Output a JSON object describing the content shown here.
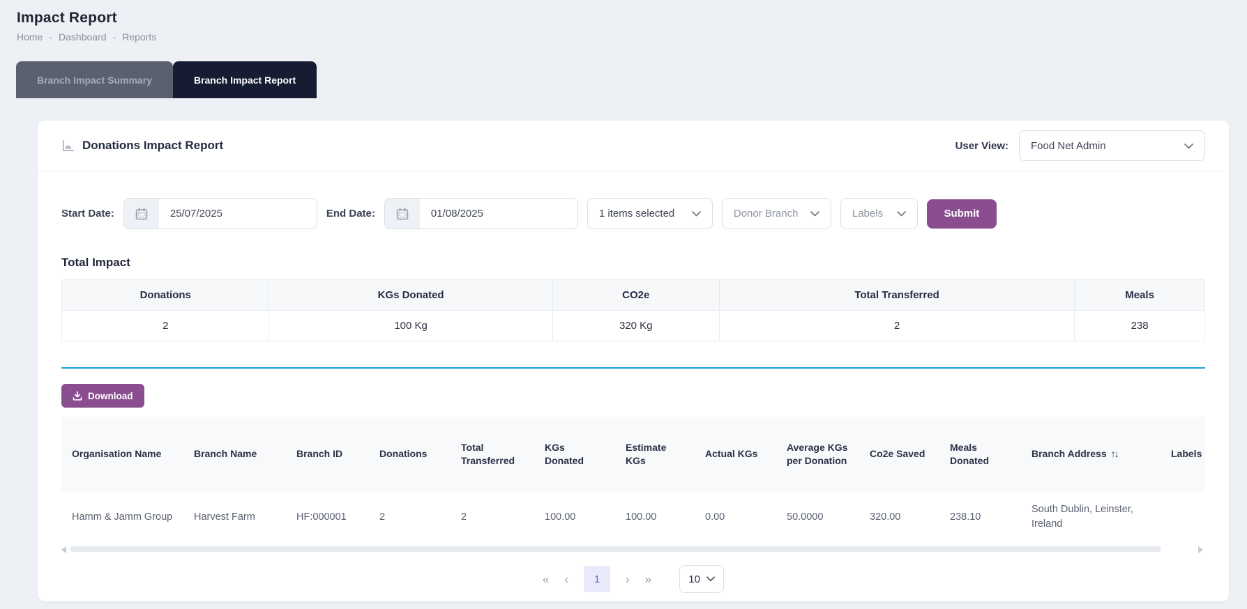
{
  "page": {
    "title": "Impact Report",
    "breadcrumb": {
      "items": [
        "Home",
        "Dashboard",
        "Reports"
      ],
      "separator": "-"
    }
  },
  "tabs": [
    {
      "label": "Branch Impact Summary",
      "active": false
    },
    {
      "label": "Branch Impact Report",
      "active": true
    }
  ],
  "card": {
    "title": "Donations Impact Report",
    "user_view": {
      "label": "User View:",
      "value": "Food Net Admin"
    },
    "filters": {
      "start_date": {
        "label": "Start Date:",
        "value": "25/07/2025"
      },
      "end_date": {
        "label": "End Date:",
        "value": "01/08/2025"
      },
      "branch_select": {
        "value": "1 items selected"
      },
      "donor_branch": {
        "value": "Donor Branch"
      },
      "labels": {
        "value": "Labels"
      },
      "submit_label": "Submit"
    },
    "total_impact": {
      "heading": "Total Impact",
      "columns": [
        "Donations",
        "KGs Donated",
        "CO2e",
        "Total Transferred",
        "Meals"
      ],
      "values": [
        "2",
        "100 Kg",
        "320 Kg",
        "2",
        "238"
      ]
    },
    "download_label": "Download",
    "report_table": {
      "columns": [
        "Organisation Name",
        "Branch Name",
        "Branch ID",
        "Donations",
        "Total Transferred",
        "KGs Donated",
        "Estimate KGs",
        "Actual KGs",
        "Average KGs per Donation",
        "Co2e Saved",
        "Meals Donated",
        "Branch Address",
        "Labels"
      ],
      "sorted_column": "Branch Address",
      "rows": [
        [
          "Hamm & Jamm Group",
          "Harvest Farm",
          "HF:000001",
          "2",
          "2",
          "100.00",
          "100.00",
          "0.00",
          "50.0000",
          "320.00",
          "238.10",
          "South Dublin, Leinster, Ireland",
          ""
        ]
      ]
    },
    "pagination": {
      "first": "«",
      "prev": "‹",
      "page": "1",
      "next": "›",
      "last": "»",
      "page_size": "10"
    }
  },
  "icons": {
    "sort": "↑↓"
  },
  "colors": {
    "accent_purple": "#8a4e90",
    "accent_blue": "#1b9fdc",
    "tab_active_bg": "#161c32",
    "tab_inactive_bg": "#5a6070",
    "page_bg": "#edf1f5",
    "pagination_active_bg": "#e8eaf9",
    "pagination_active_text": "#5d6bc8"
  }
}
